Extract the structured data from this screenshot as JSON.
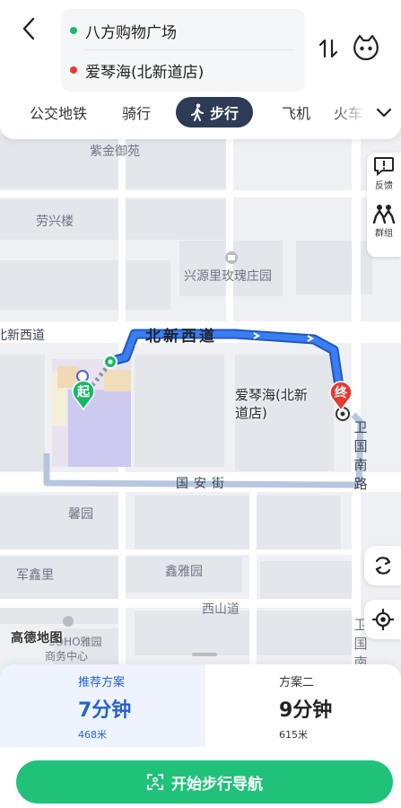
{
  "header": {
    "origin": "八方购物广场",
    "destination": "爱琴海(北新道店)",
    "origin_dot_color": "#19b866",
    "destination_dot_color": "#e53935"
  },
  "modes": [
    {
      "label": "公交地铁",
      "active": false
    },
    {
      "label": "骑行",
      "active": false
    },
    {
      "label": "步行",
      "active": true
    },
    {
      "label": "飞机",
      "active": false
    },
    {
      "label": "火车",
      "active": false
    }
  ],
  "side_tools": {
    "feedback_label": "反馈",
    "group_label": "群组"
  },
  "map": {
    "labels": {
      "zijin": "紫金御苑",
      "laoxing": "劳兴楼",
      "xingyuan": "兴源里玫瑰庄园",
      "beixinxi_left": "北新西道",
      "beixinxi_road": "北新西道",
      "guoan": "国安街",
      "xinyuan": "馨园",
      "junxinli": "军鑫里",
      "xinya": "鑫雅园",
      "xishan": "西山道",
      "soho": "SOHO雅园",
      "shangwu": "商务中心",
      "weiguo_top": "卫国南路",
      "weiguo_bottom": "卫国南",
      "dest_name": "爱琴海(北新道店)"
    },
    "start_marker": "起",
    "end_marker": "终",
    "logo": "高德地图",
    "route_color": "#2f6ee0"
  },
  "plans": [
    {
      "tag": "推荐方案",
      "time": "7分钟",
      "distance": "468米",
      "selected": true
    },
    {
      "tag": "方案二",
      "time": "9分钟",
      "distance": "615米",
      "selected": false
    }
  ],
  "action": {
    "navigate_label": "开始步行导航",
    "color": "#20c27a"
  }
}
